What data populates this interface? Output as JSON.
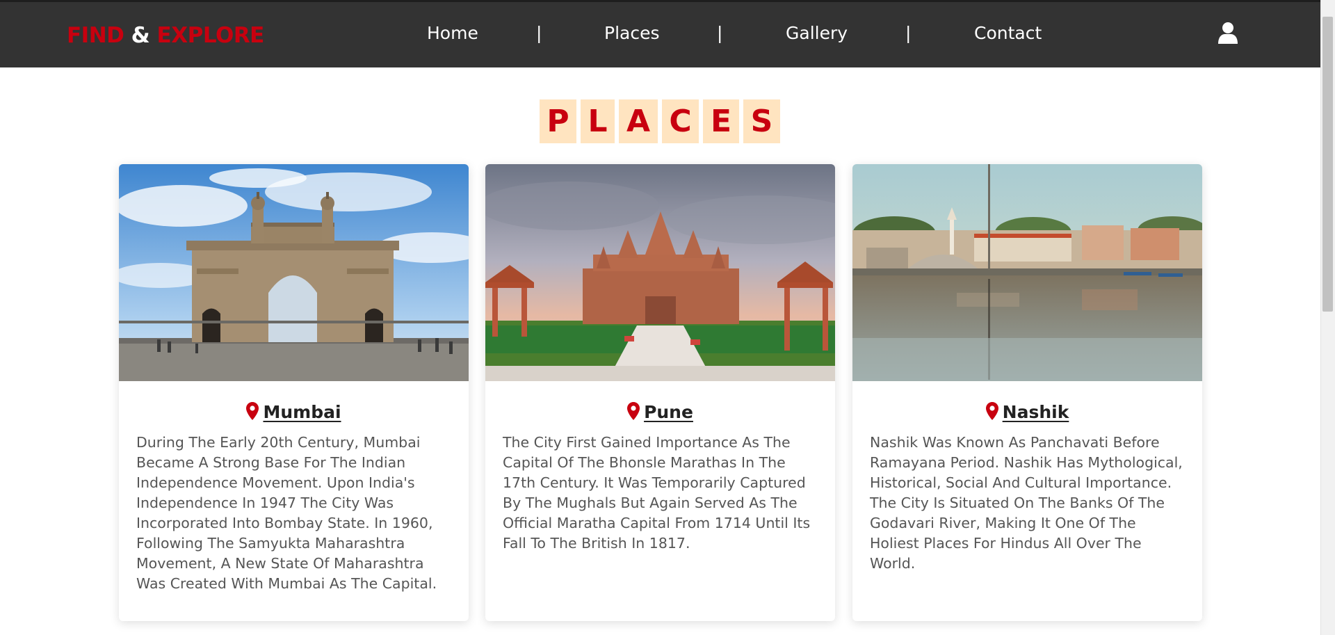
{
  "navbar": {
    "brand": {
      "part1": "FIND",
      "amp": " & ",
      "part2": "EXPLORE"
    },
    "links": [
      "Home",
      "Places",
      "Gallery",
      "Contact"
    ],
    "separator": "|",
    "user_icon": "user-icon"
  },
  "heading": {
    "letters": [
      "P",
      "L",
      "A",
      "C",
      "E",
      "S"
    ]
  },
  "cards": [
    {
      "title": "Mumbai",
      "image": "gateway-of-india-photo",
      "text": "During The Early 20th Century, Mumbai Became A Strong Base For The Indian Independence Movement. Upon India's Independence In 1947 The City Was Incorporated Into Bombay State. In 1960, Following The Samyukta Maharashtra Movement, A New State Of Maharashtra Was Created With Mumbai As The Capital."
    },
    {
      "title": "Pune",
      "image": "swaminarayan-temple-photo",
      "text": "The City First Gained Importance As The Capital Of The Bhonsle Marathas In The 17th Century. It Was Temporarily Captured By The Mughals But Again Served As The Official Maratha Capital From 1714 Until Its Fall To The British In 1817."
    },
    {
      "title": "Nashik",
      "image": "godavari-river-ghat-photo",
      "text": "Nashik Was Known As Panchavati Before Ramayana Period. Nashik Has Mythological, Historical, Social And Cultural Importance. The City Is Situated On The Banks Of The Godavari River, Making It One Of The Holiest Places For Hindus All Over The World."
    }
  ],
  "colors": {
    "accent": "#c8000f",
    "navbar_bg": "#333333",
    "letter_bg": "#ffe4c0"
  }
}
